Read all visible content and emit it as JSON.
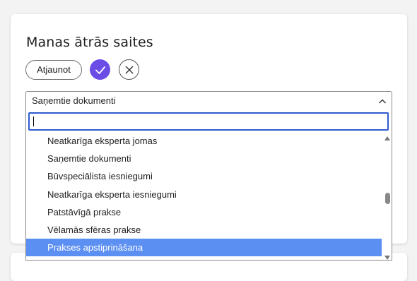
{
  "panel": {
    "title": "Manas ātrās saites",
    "refresh_label": "Atjaunot"
  },
  "icons": {
    "confirm": "check-icon",
    "cancel": "close-icon",
    "expand": "chevron-up-icon"
  },
  "colors": {
    "accent": "#6b4de6",
    "selection": "#5b8ff2",
    "focus_border": "#2f5bd0"
  },
  "select": {
    "value": "Saņemtie dokumenti",
    "search_value": ""
  },
  "options": [
    {
      "label": "Neatkarīga eksperta jomas",
      "selected": false
    },
    {
      "label": "Saņemtie dokumenti",
      "selected": false
    },
    {
      "label": "Būvspeciālista iesniegumi",
      "selected": false
    },
    {
      "label": "Neatkarīga eksperta iesniegumi",
      "selected": false
    },
    {
      "label": "Patstāvīgā prakse",
      "selected": false
    },
    {
      "label": "Vēlamās sfēras prakse",
      "selected": false
    },
    {
      "label": "Prakses apstiprināšana",
      "selected": true
    }
  ]
}
